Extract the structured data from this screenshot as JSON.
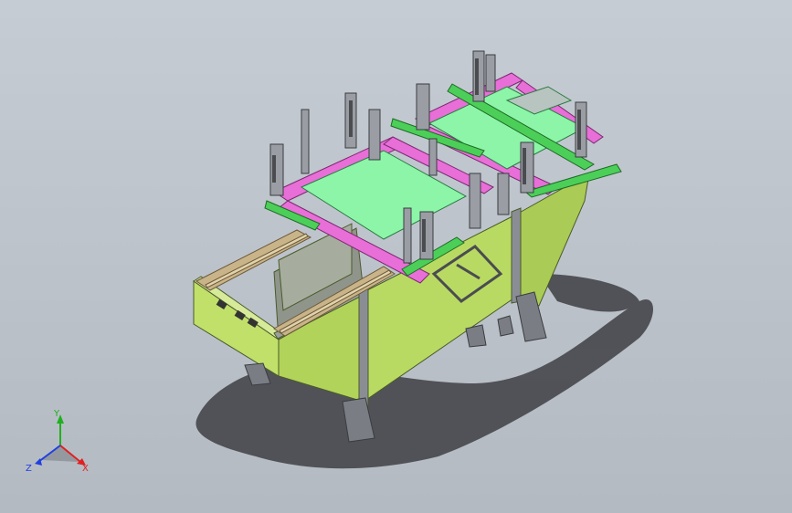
{
  "viewport": {
    "kind": "cad-3d-view",
    "background_colors": [
      "#c6ccd4",
      "#b4bac2"
    ]
  },
  "model": {
    "frame_color": "#b7d860",
    "frame_edge_color": "#4a5a2a",
    "fixture_plate_color": "#8cf5a8",
    "clamp_bar_color": "#e86ed8",
    "green_rail_color": "#4ccf58",
    "rail_color": "#c9b48a",
    "steel_color": "#8a8e94",
    "shadow_color": "#3e3f44"
  },
  "triad": {
    "x_label": "X",
    "y_label": "Y",
    "z_label": "Z",
    "x_color": "#e02020",
    "y_color": "#20b020",
    "z_color": "#2040e0"
  }
}
